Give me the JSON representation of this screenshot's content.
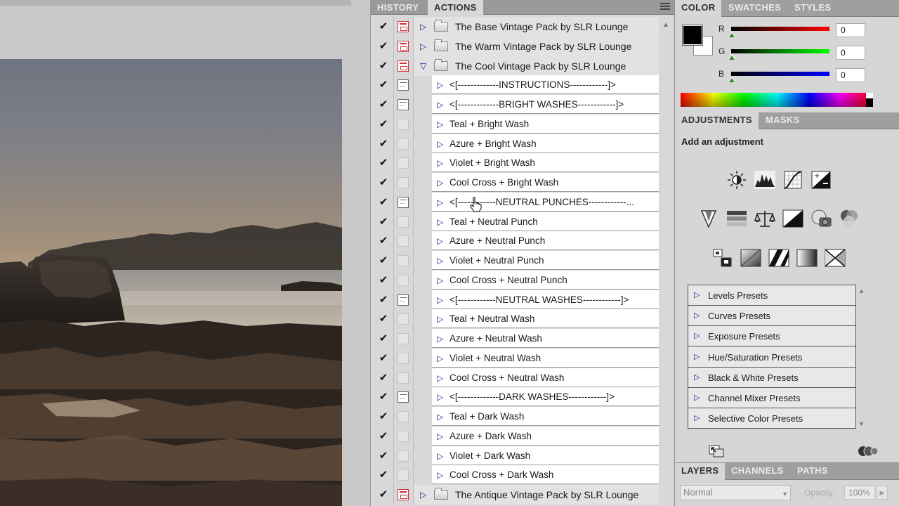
{
  "actions_panel": {
    "tabs": [
      {
        "label": "HISTORY",
        "active": false
      },
      {
        "label": "ACTIONS",
        "active": true
      }
    ],
    "rows": [
      {
        "type": "set",
        "name": "The Base Vintage Pack by SLR Lounge",
        "checked": true,
        "dialog": "red",
        "expanded": false
      },
      {
        "type": "set",
        "name": "The Warm Vintage Pack by SLR Lounge",
        "checked": true,
        "dialog": "red",
        "expanded": false
      },
      {
        "type": "set",
        "name": "The Cool Vintage Pack by SLR Lounge",
        "checked": true,
        "dialog": "red",
        "expanded": true
      },
      {
        "type": "action",
        "name": "<[-------------INSTRUCTIONS------------]>",
        "checked": true,
        "dialog": "gray"
      },
      {
        "type": "action",
        "name": "<[-------------BRIGHT WASHES------------]>",
        "checked": true,
        "dialog": "gray"
      },
      {
        "type": "action",
        "name": "Teal + Bright Wash",
        "checked": true,
        "dialog": "empty"
      },
      {
        "type": "action",
        "name": "Azure + Bright Wash",
        "checked": true,
        "dialog": "empty"
      },
      {
        "type": "action",
        "name": "Violet + Bright Wash",
        "checked": true,
        "dialog": "empty"
      },
      {
        "type": "action",
        "name": "Cool Cross + Bright Wash",
        "checked": true,
        "dialog": "empty"
      },
      {
        "type": "action",
        "name": "<[------------NEUTRAL PUNCHES------------...",
        "checked": true,
        "dialog": "gray"
      },
      {
        "type": "action",
        "name": "Teal + Neutral Punch",
        "checked": true,
        "dialog": "empty"
      },
      {
        "type": "action",
        "name": "Azure + Neutral Punch",
        "checked": true,
        "dialog": "empty"
      },
      {
        "type": "action",
        "name": "Violet + Neutral Punch",
        "checked": true,
        "dialog": "empty"
      },
      {
        "type": "action",
        "name": "Cool Cross + Neutral Punch",
        "checked": true,
        "dialog": "empty"
      },
      {
        "type": "action",
        "name": "<[------------NEUTRAL WASHES------------]>",
        "checked": true,
        "dialog": "gray"
      },
      {
        "type": "action",
        "name": "Teal + Neutral Wash",
        "checked": true,
        "dialog": "empty"
      },
      {
        "type": "action",
        "name": "Azure + Neutral Wash",
        "checked": true,
        "dialog": "empty"
      },
      {
        "type": "action",
        "name": "Violet + Neutral Wash",
        "checked": true,
        "dialog": "empty"
      },
      {
        "type": "action",
        "name": "Cool Cross + Neutral Wash",
        "checked": true,
        "dialog": "empty"
      },
      {
        "type": "action",
        "name": "<[-------------DARK WASHES------------]>",
        "checked": true,
        "dialog": "gray"
      },
      {
        "type": "action",
        "name": "Teal + Dark Wash",
        "checked": true,
        "dialog": "empty"
      },
      {
        "type": "action",
        "name": "Azure + Dark Wash",
        "checked": true,
        "dialog": "empty"
      },
      {
        "type": "action",
        "name": "Violet + Dark Wash",
        "checked": true,
        "dialog": "empty"
      },
      {
        "type": "action",
        "name": "Cool Cross + Dark Wash",
        "checked": true,
        "dialog": "empty"
      },
      {
        "type": "set",
        "name": "The Antique Vintage Pack by SLR Lounge",
        "checked": true,
        "dialog": "red",
        "expanded": false
      }
    ],
    "check_glyph": "✔",
    "collapsed_glyph": "▷",
    "expanded_glyph": "▽"
  },
  "color_panel": {
    "tabs": [
      {
        "label": "COLOR",
        "active": true
      },
      {
        "label": "SWATCHES",
        "active": false
      },
      {
        "label": "STYLES",
        "active": false
      }
    ],
    "channels": [
      {
        "label": "R",
        "value": "0"
      },
      {
        "label": "G",
        "value": "0"
      },
      {
        "label": "B",
        "value": "0"
      }
    ],
    "foreground": "#000000",
    "background": "#ffffff"
  },
  "adjustments_panel": {
    "tabs": [
      {
        "label": "ADJUSTMENTS",
        "active": true
      },
      {
        "label": "MASKS",
        "active": false
      }
    ],
    "title": "Add an adjustment",
    "icon_rows": [
      [
        "brightness-contrast-icon",
        "levels-icon",
        "curves-icon",
        "exposure-icon"
      ],
      [
        "vibrance-icon",
        "hue-saturation-icon",
        "color-balance-icon",
        "black-white-icon",
        "photo-filter-icon",
        "channel-mixer-icon"
      ],
      [
        "invert-icon",
        "posterize-icon",
        "threshold-icon",
        "gradient-map-icon",
        "selective-color-icon"
      ]
    ],
    "presets": [
      "Levels Presets",
      "Curves Presets",
      "Exposure Presets",
      "Hue/Saturation Presets",
      "Black & White Presets",
      "Channel Mixer Presets",
      "Selective Color Presets"
    ]
  },
  "layers_panel": {
    "tabs": [
      {
        "label": "LAYERS",
        "active": true
      },
      {
        "label": "CHANNELS",
        "active": false
      },
      {
        "label": "PATHS",
        "active": false
      }
    ],
    "blend_mode": "Normal",
    "opacity_label": "Opacity:",
    "opacity_value": "100%"
  }
}
